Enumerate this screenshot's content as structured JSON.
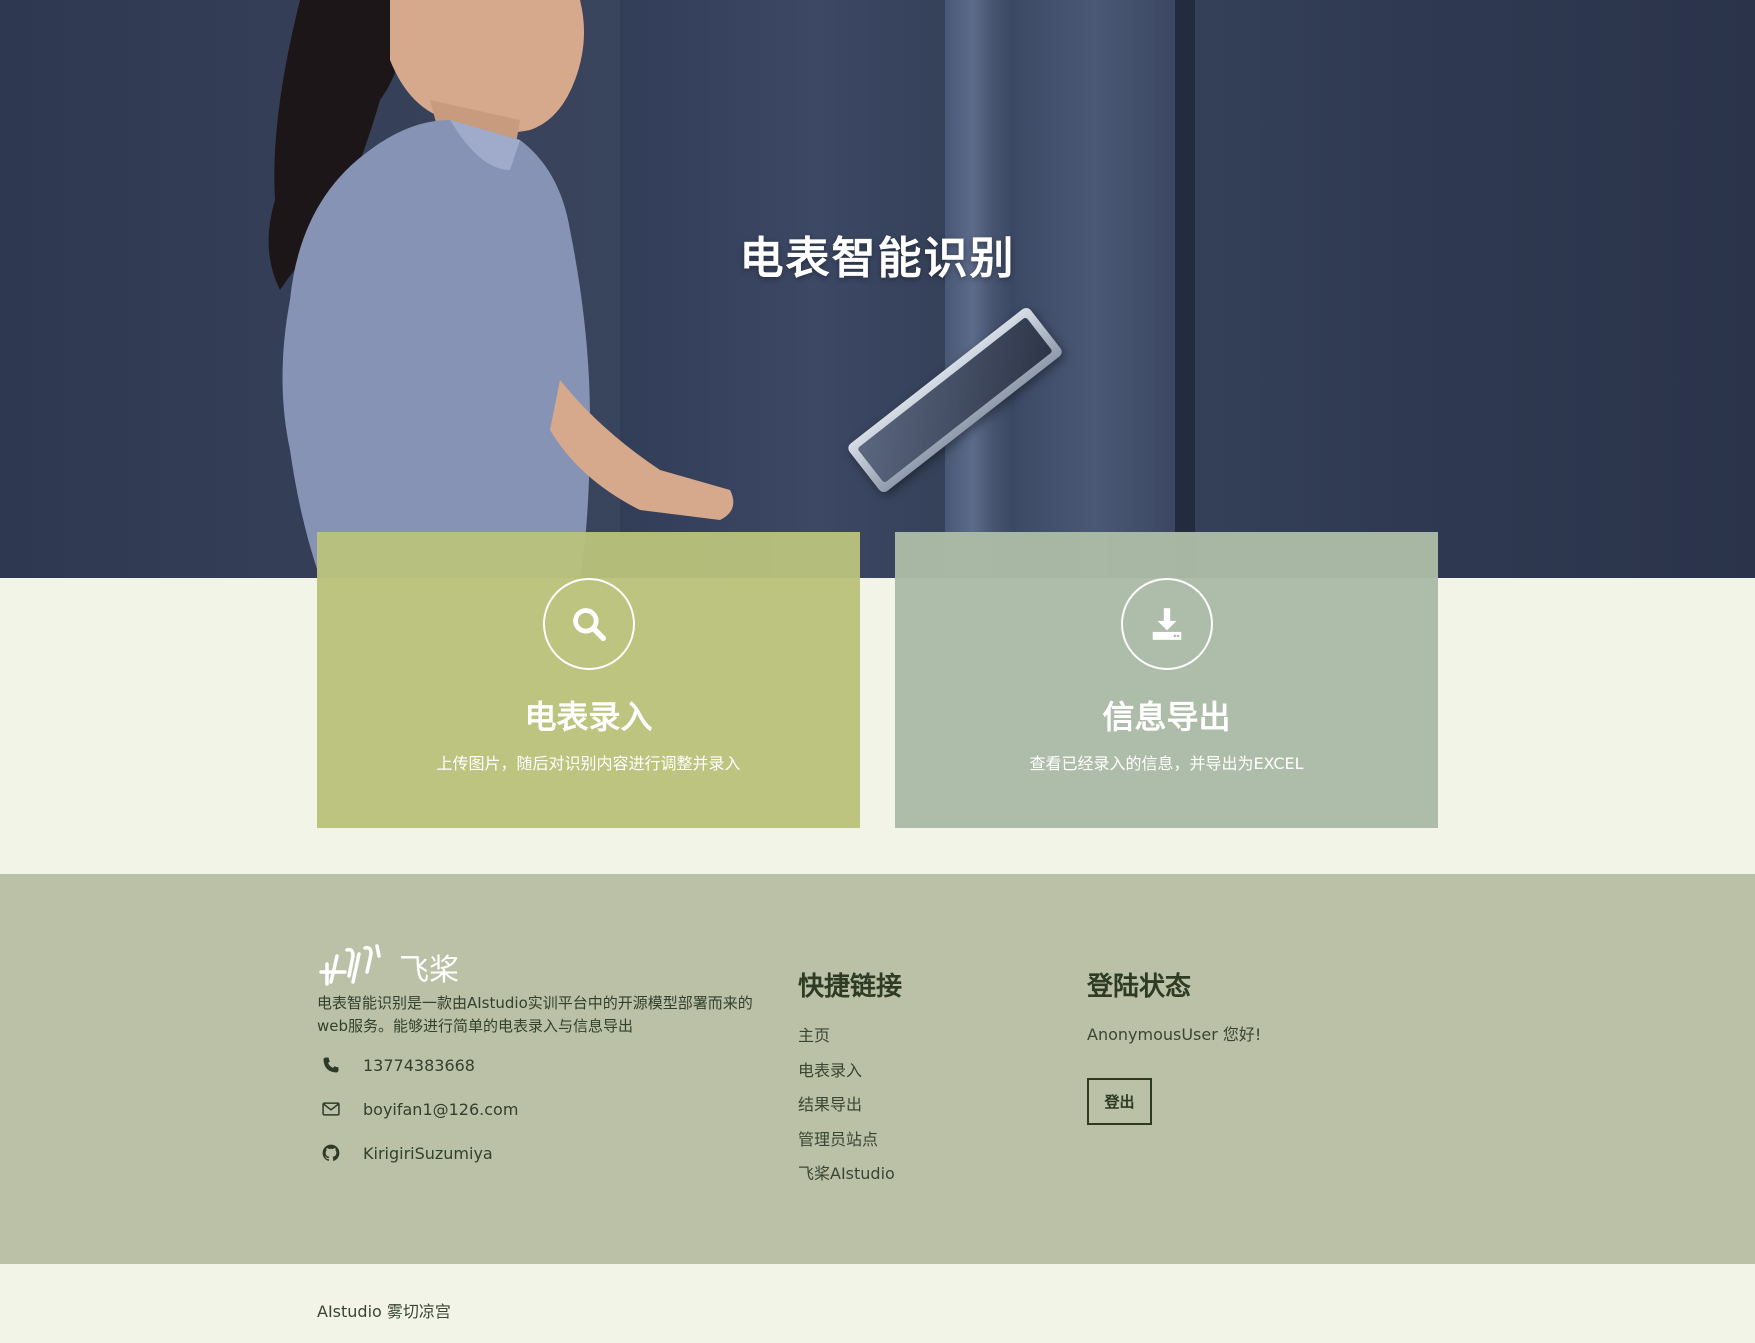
{
  "hero": {
    "title": "电表智能识别"
  },
  "cards": [
    {
      "icon": "search-icon",
      "title": "电表录入",
      "desc": "上传图片，随后对识别内容进行调整并录入",
      "color": "#b9c27c"
    },
    {
      "icon": "download-icon",
      "title": "信息导出",
      "desc": "查看已经录入的信息，并导出为EXCEL",
      "color": "#abbba6"
    }
  ],
  "footer": {
    "logo_text": "飞桨",
    "about": "电表智能识别是一款由AIstudio实训平台中的开源模型部署而来的web服务。能够进行简单的电表录入与信息导出",
    "contacts": [
      {
        "icon": "phone-icon",
        "text": "13774383668"
      },
      {
        "icon": "mail-icon",
        "text": "boyifan1@126.com"
      },
      {
        "icon": "github-icon",
        "text": "KirigiriSuzumiya"
      }
    ],
    "links_title": "快捷链接",
    "links": [
      "主页",
      "电表录入",
      "结果导出",
      "管理员站点",
      "飞桨AIstudio"
    ],
    "status_title": "登陆状态",
    "status_text": "AnonymousUser 您好!",
    "logout_label": "登出"
  },
  "copyright": "AIstudio 雾切凉宫",
  "colors": {
    "page_bg": "#f1f4e6",
    "footer_bg": "#bbc1a6",
    "card1": "#b9c27c",
    "card2": "#abbba6",
    "footer_heading": "#2f3c25"
  }
}
